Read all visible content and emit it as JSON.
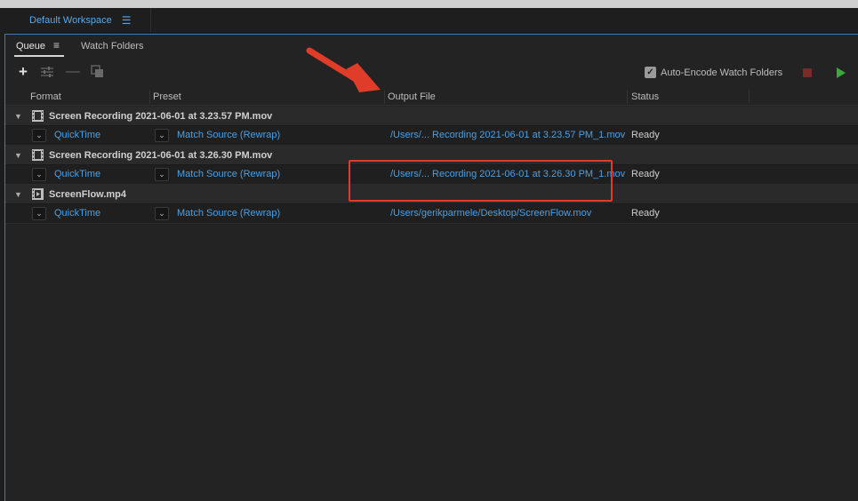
{
  "workspace": {
    "title": "Default Workspace"
  },
  "panel": {
    "tabs": {
      "queue": "Queue",
      "watch_folders": "Watch Folders"
    },
    "toolbar": {
      "auto_encode_label": "Auto-Encode Watch Folders",
      "auto_encode_checked": true
    },
    "columns": {
      "format": "Format",
      "preset": "Preset",
      "output": "Output File",
      "status": "Status"
    },
    "groups": [
      {
        "title": "Screen Recording 2021-06-01 at 3.23.57 PM.mov",
        "item": {
          "format": "QuickTime",
          "preset": "Match Source (Rewrap)",
          "output": "/Users/... Recording 2021-06-01 at 3.23.57 PM_1.mov",
          "status": "Ready"
        }
      },
      {
        "title": "Screen Recording 2021-06-01 at 3.26.30 PM.mov",
        "item": {
          "format": "QuickTime",
          "preset": "Match Source (Rewrap)",
          "output": "/Users/... Recording 2021-06-01 at 3.26.30 PM_1.mov",
          "status": "Ready"
        }
      },
      {
        "title": "ScreenFlow.mp4",
        "item": {
          "format": "QuickTime",
          "preset": "Match Source (Rewrap)",
          "output": "/Users/gerikparmele/Desktop/ScreenFlow.mov",
          "status": "Ready"
        }
      }
    ]
  },
  "colors": {
    "accent": "#4f9fe0",
    "annotation": "#e03c2a",
    "play": "#3aaa3a",
    "stop": "#7b2a2a"
  }
}
